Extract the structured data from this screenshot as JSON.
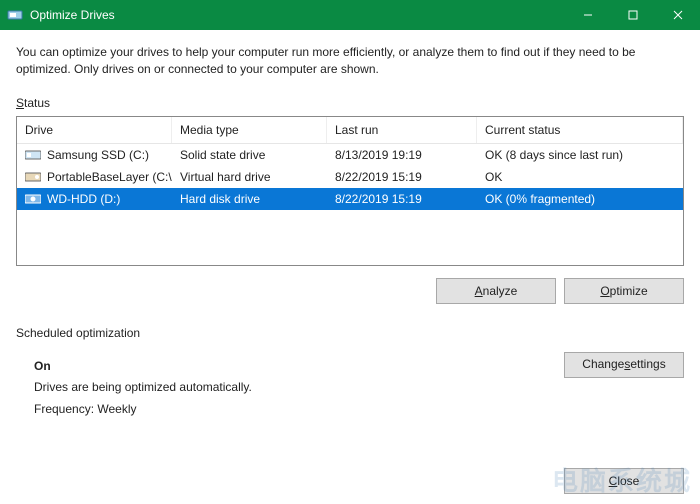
{
  "titlebar": {
    "title": "Optimize Drives"
  },
  "intro": "You can optimize your drives to help your computer run more efficiently, or analyze them to find out if they need to be optimized. Only drives on or connected to your computer are shown.",
  "status_label_pre": "S",
  "status_label_rest": "tatus",
  "columns": {
    "drive": "Drive",
    "media": "Media type",
    "last": "Last run",
    "status": "Current status"
  },
  "rows": [
    {
      "icon": "ssd",
      "drive": "Samsung SSD (C:)",
      "media": "Solid state drive",
      "last": "8/13/2019 19:19",
      "status": "OK (8 days since last run)",
      "selected": false
    },
    {
      "icon": "vhd",
      "drive": "PortableBaseLayer (C:\\...",
      "media": "Virtual hard drive",
      "last": "8/22/2019 15:19",
      "status": "OK",
      "selected": false
    },
    {
      "icon": "hdd",
      "drive": "WD-HDD (D:)",
      "media": "Hard disk drive",
      "last": "8/22/2019 15:19",
      "status": "OK (0% fragmented)",
      "selected": true
    }
  ],
  "buttons": {
    "analyze_pre": "A",
    "analyze_rest": "nalyze",
    "optimize_pre": "O",
    "optimize_rest": "ptimize",
    "change_pre": "Change ",
    "change_und": "s",
    "change_rest": "ettings",
    "close_pre": "C",
    "close_rest": "lose"
  },
  "scheduled": {
    "label": "Scheduled optimization",
    "on": "On",
    "desc": "Drives are being optimized automatically.",
    "freq": "Frequency: Weekly"
  },
  "watermark": "电脑系统城"
}
